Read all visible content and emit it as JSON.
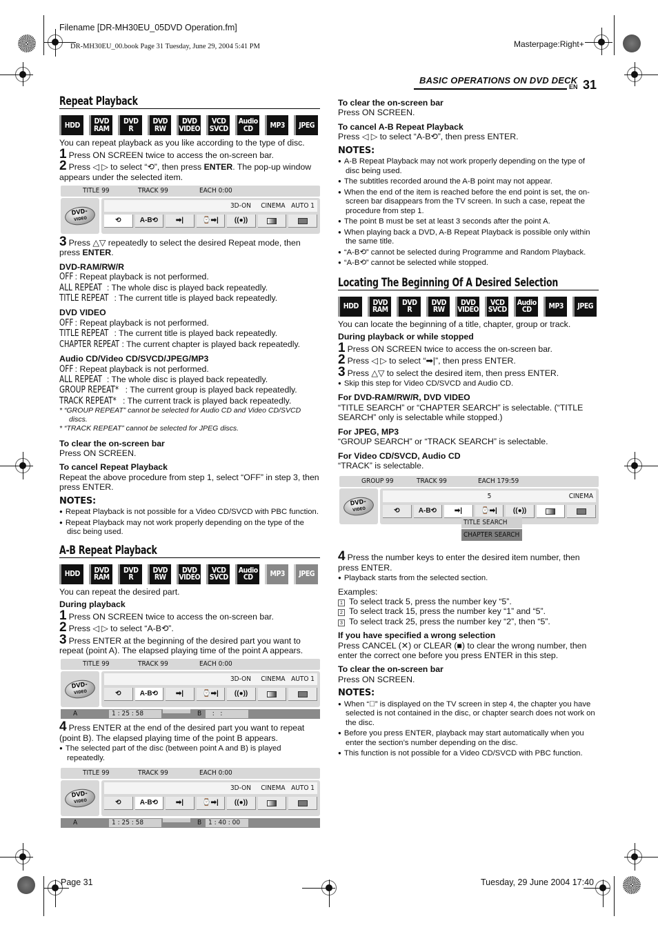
{
  "header": {
    "filename": "Filename [DR-MH30EU_05DVD Operation.fm]",
    "book_info": "DR-MH30EU_00.book  Page 31  Tuesday, June 29, 2004  5:41 PM",
    "masterpage": "Masterpage:Right+",
    "section_title": "BASIC OPERATIONS ON DVD DECK",
    "lang": "EN",
    "page_number": "31"
  },
  "footer": {
    "page": "Page 31",
    "date": "Tuesday, 29 June 2004  17:40"
  },
  "badges": [
    "HDD",
    "DVD\nRAM",
    "DVD\nR",
    "DVD\nRW",
    "DVD\nVIDEO",
    "VCD\nSVCD",
    "Audio\nCD",
    "MP3",
    "JPEG"
  ],
  "osd": {
    "title": "TITLE 99",
    "track": "TRACK 99",
    "each": "EACH 0:00",
    "mode3d": "3D-ON",
    "cinema": "CINEMA",
    "auto": "AUTO 1",
    "logo_top": "DVD-",
    "logo_bottom": "VIDEO",
    "btn_repeat": "⟲",
    "btn_ab": "A-B⟲",
    "btn_search": "➡|",
    "btn_time": "⌚➡|",
    "btn_audio": "((●))",
    "a_label": "A",
    "b_label": "B",
    "a_time": "1 : 25 : 58",
    "b_time_empty": "  :   :",
    "b_time": "1 : 40 : 00"
  },
  "osd_locate": {
    "group": "GROUP 99",
    "track": "TRACK 99",
    "each": "EACH 179:59",
    "number": "5",
    "cinema": "CINEMA",
    "popup_items": [
      "TITLE SEARCH",
      "CHAPTER SEARCH"
    ]
  },
  "repeat": {
    "title": "Repeat Playback",
    "intro": "You can repeat playback as you like according to the type of disc.",
    "step1": "Press ON SCREEN twice to access the on-screen bar.",
    "step2_a": "Press ◁ ▷ to select “⟲”, then press ",
    "step2_b": "ENTER",
    "step2_c": ". The pop-up window appears under the selected item.",
    "step3_a": "Press △▽ repeatedly to select the desired Repeat mode, then press ",
    "step3_b": "ENTER",
    "groups": [
      {
        "heading": "DVD-RAM/RW/R",
        "items": [
          {
            "mode": "OFF",
            "desc": ": Repeat playback is not performed."
          },
          {
            "mode": "ALL REPEAT",
            "desc": ": The whole disc is played back repeatedly."
          },
          {
            "mode": "TITLE REPEAT",
            "desc": ": The current title is played back repeatedly."
          }
        ]
      },
      {
        "heading": "DVD VIDEO",
        "items": [
          {
            "mode": "OFF",
            "desc": ": Repeat playback is not performed."
          },
          {
            "mode": "TITLE REPEAT",
            "desc": ": The current title is played back repeatedly."
          },
          {
            "mode": "CHAPTER REPEAT",
            "desc": ": The current chapter is played back repeatedly."
          }
        ]
      },
      {
        "heading": "Audio CD/Video CD/SVCD/JPEG/MP3",
        "items": [
          {
            "mode": "OFF",
            "desc": ": Repeat playback is not performed."
          },
          {
            "mode": "ALL REPEAT",
            "desc": ": The whole disc is played back repeatedly."
          },
          {
            "mode": "GROUP REPEAT*",
            "desc": ": The current group is played back repeatedly."
          },
          {
            "mode": "TRACK REPEAT*",
            "desc": ": The current track is played back repeatedly."
          }
        ]
      }
    ],
    "footnote1": "*  “GROUP REPEAT” cannot be selected for Audio CD and Video CD/SVCD discs.",
    "footnote2": "*  “TRACK REPEAT” cannot be selected for JPEG discs.",
    "clear_heading": "To clear the on-screen bar",
    "clear_text": "Press ON SCREEN.",
    "cancel_heading": "To cancel Repeat Playback",
    "cancel_text": "Repeat the above procedure from step 1, select “OFF” in step 3, then press ENTER.",
    "notes_heading": "NOTES:",
    "notes": [
      "Repeat Playback is not possible for a Video CD/SVCD with PBC function.",
      "Repeat Playback may not work properly depending on the type of the disc being used."
    ]
  },
  "ab": {
    "title": "A-B Repeat Playback",
    "intro": "You can repeat the desired part.",
    "during": "During playback",
    "step1": "Press ON SCREEN twice to access the on-screen bar.",
    "step2": "Press ◁ ▷ to select “A-B⟲”.",
    "step3": "Press ENTER at the beginning of the desired part you want to repeat (point A). The elapsed playing time of the point A appears.",
    "step4": "Press ENTER at the end of the desired part you want to repeat (point B). The elapsed playing time of the point B appears.",
    "step4_bullet": "The selected part of the disc (between point A and B) is played repeatedly.",
    "clear_heading": "To clear the on-screen bar",
    "clear_text": "Press ON SCREEN.",
    "cancel_heading": "To cancel A-B Repeat Playback",
    "cancel_text": "Press ◁ ▷ to select “A-B⟲”, then press ENTER.",
    "notes_heading": "NOTES:",
    "notes": [
      "A-B Repeat Playback may not work properly depending on the type of disc being used.",
      "The subtitles recorded around the A-B point may not appear.",
      "When the end of the item is reached before the end point is set, the on-screen bar disappears from the TV screen. In such a case, repeat the procedure from step 1.",
      "The point B must be set at least 3 seconds after the point A.",
      "When playing back a DVD, A-B Repeat Playback is possible only within the same title.",
      "“A-B⟲” cannot be selected during Programme and Random Playback.",
      "“A-B⟲” cannot be selected while stopped."
    ]
  },
  "locate": {
    "title": "Locating The Beginning Of A Desired Selection",
    "intro": "You can locate the beginning of a title, chapter, group or track.",
    "during": "During playback or while stopped",
    "step1": "Press ON SCREEN twice to access the on-screen bar.",
    "step2": "Press ◁ ▷ to select “➡|”, then press ENTER.",
    "step3": "Press △▽ to select the desired item, then press ENTER.",
    "step3_bullet": "Skip this step for Video CD/SVCD and Audio CD.",
    "for1_heading": "For DVD-RAM/RW/R, DVD VIDEO",
    "for1_text": "“TITLE SEARCH” or “CHAPTER SEARCH” is selectable. (“TITLE SEARCH” only is selectable while stopped.)",
    "for2_heading": "For JPEG, MP3",
    "for2_text": "“GROUP SEARCH” or “TRACK SEARCH” is selectable.",
    "for3_heading": "For Video CD/SVCD, Audio CD",
    "for3_text": "“TRACK” is selectable.",
    "step4": "Press the number keys to enter the desired item number, then press ENTER.",
    "step4_bullet": "Playback starts from the selected section.",
    "examples_heading": "Examples:",
    "examples": [
      "To select track 5, press the number key “5”.",
      "To select track 15, press the number key “1” and “5”.",
      "To select track 25, press the number key “2”, then “5”."
    ],
    "wrong_heading": "If you have specified a wrong selection",
    "wrong_text": "Press CANCEL (✕) or CLEAR (■) to clear the wrong number, then enter the correct one before you press ENTER in this step.",
    "clear_heading": "To clear the on-screen bar",
    "clear_text": "Press ON SCREEN.",
    "notes_heading": "NOTES:",
    "notes": [
      "When “⃠” is displayed on the TV screen in step 4, the chapter you have selected is not contained in the disc, or chapter search does not work on the disc.",
      "Before you press ENTER, playback may start automatically when you enter the section’s number depending on the disc.",
      "This function is not possible for a Video CD/SVCD with PBC function."
    ]
  }
}
